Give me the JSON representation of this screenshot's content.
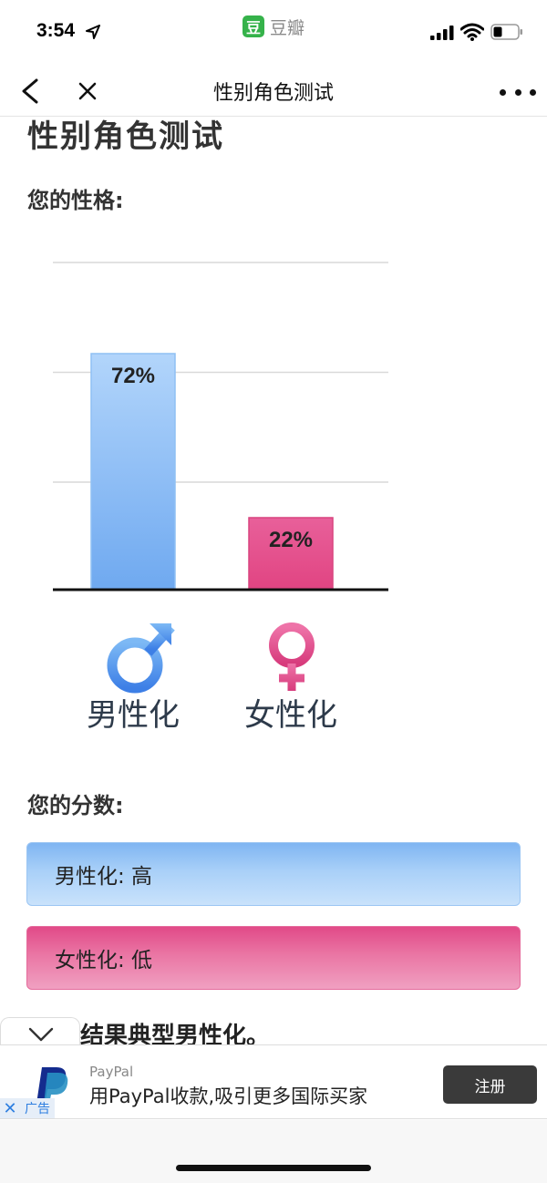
{
  "status_bar": {
    "time": "3:54",
    "carrier": "豆瓣",
    "carrier_icon": "豆"
  },
  "nav": {
    "title": "性别角色测试",
    "back_icon": "chevron-left-icon",
    "close_icon": "close-icon",
    "more_icon": "more-icon"
  },
  "page": {
    "title": "性别角色测试",
    "personality_label": "您的性格:",
    "score_label": "您的分数:",
    "result_text": "结果典型男性化。"
  },
  "chart_data": {
    "type": "bar",
    "categories": [
      "男性化",
      "女性化"
    ],
    "values": [
      72,
      22
    ],
    "value_labels": [
      "72%",
      "22%"
    ],
    "ylim": [
      0,
      100
    ],
    "grid": true,
    "colors": [
      "#7ab3f3",
      "#e54c8c"
    ],
    "icons": [
      "male-symbol-icon",
      "female-symbol-icon"
    ]
  },
  "scores": {
    "male": "男性化: 高",
    "female": "女性化: 低",
    "male_color": "#8ec0f5",
    "female_color": "#e8609a"
  },
  "ad": {
    "brand": "PayPal",
    "text": "用PayPal收款,吸引更多国际买家",
    "button": "注册",
    "tag": "广告",
    "close": "✕"
  }
}
